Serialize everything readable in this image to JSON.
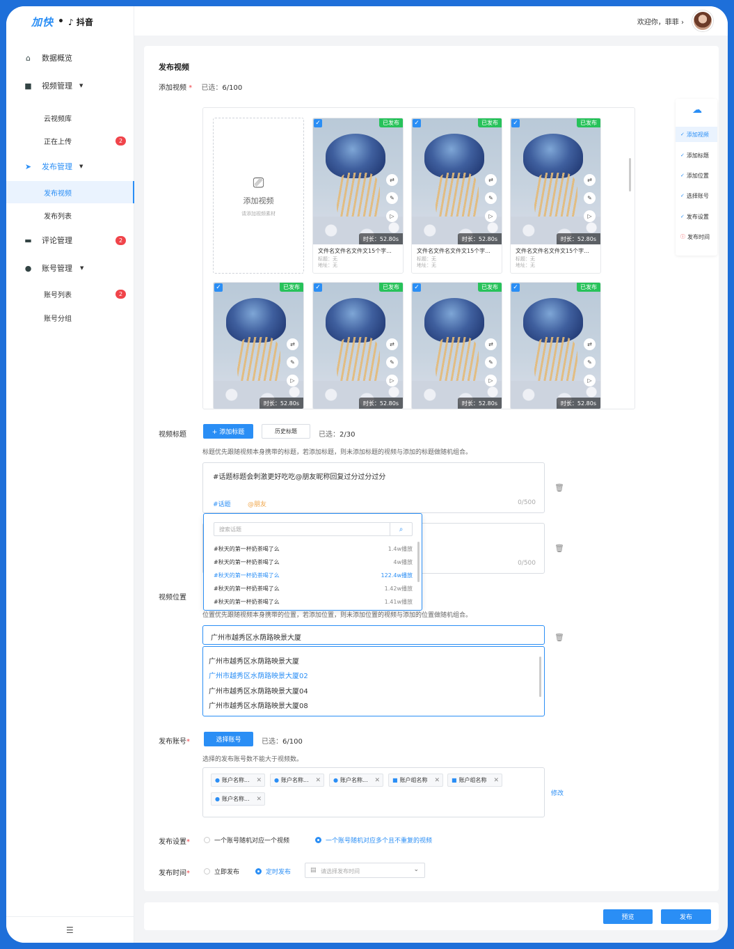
{
  "brand": {
    "left": "加快",
    "sep": "•",
    "right": "抖音"
  },
  "header": {
    "welcome": "欢迎你，菲菲 ›"
  },
  "sidebar": {
    "items": [
      {
        "label": "数据概览",
        "icon": "home-icon"
      },
      {
        "label": "视频管理",
        "icon": "video-icon"
      },
      {
        "label": "云视频库"
      },
      {
        "label": "正在上传",
        "badge": "2"
      },
      {
        "label": "发布管理",
        "icon": "send-icon"
      },
      {
        "label": "发布视频"
      },
      {
        "label": "发布列表"
      },
      {
        "label": "评论管理",
        "icon": "comment-icon",
        "badge": "2"
      },
      {
        "label": "账号管理",
        "icon": "user-icon"
      },
      {
        "label": "账号列表",
        "badge": "2"
      },
      {
        "label": "账号分组"
      }
    ],
    "collapse_icon": "☰"
  },
  "page": {
    "title": "发布视频",
    "add_video": {
      "label": "添加视频",
      "star": "*",
      "selected_label": "已选：",
      "selected": "6/100",
      "tile_title": "添加视频",
      "tile_sub": "请添加视频素材"
    },
    "videos": [
      {
        "status": "已发布",
        "duration": "时长：52.80s",
        "name": "文件名文件名文件文15个字...",
        "title": "标题：无",
        "addr": "地址：无"
      },
      {
        "status": "已发布",
        "duration": "时长：52.80s",
        "name": "文件名文件名文件文15个字...",
        "title": "标题：无",
        "addr": "地址：无"
      },
      {
        "status": "已发布",
        "duration": "时长：52.80s",
        "name": "文件名文件名文件文15个字...",
        "title": "标题：无",
        "addr": "地址：无"
      },
      {
        "status": "已发布",
        "duration": "时长：52.80s"
      },
      {
        "status": "已发布",
        "duration": "时长：52.80s"
      },
      {
        "status": "已发布",
        "duration": "时长：52.80s"
      },
      {
        "status": "已发布",
        "duration": "时长：52.80s"
      }
    ],
    "video_title": {
      "label": "视频标题",
      "add_btn": "+ 添加标题",
      "history_btn": "历史标题",
      "selected_label": "已选：",
      "selected": "2/30",
      "hint": "标题优先跟随视频本身携带的标题，若添加标题，则未添加标题的视频与添加的标题做随机组合。",
      "text1": "#话题标题会刺激更好吃吃@朋友昵称回复过分过分过分",
      "tag1": "#话题",
      "tag2": "@朋友",
      "count1": "0/500",
      "count2": "0/500"
    },
    "topic_dropdown": {
      "placeholder": "搜索话题",
      "rows": [
        {
          "name": "#秋天的第一杯奶茶喝了么",
          "plays": "1.4w播放"
        },
        {
          "name": "#秋天的第一杯奶茶喝了么",
          "plays": "4w播放"
        },
        {
          "name": "#秋天的第一杯奶茶喝了么",
          "plays": "122.4w播放"
        },
        {
          "name": "#秋天的第一杯奶茶喝了么",
          "plays": "1.42w播放"
        },
        {
          "name": "#秋天的第一杯奶茶喝了么",
          "plays": "1.41w播放"
        }
      ]
    },
    "location": {
      "label": "视频位置",
      "hint": "位置优先跟随视频本身携带的位置，若添加位置，则未添加位置的视频与添加的位置做随机组合。",
      "value": "广州市越秀区水荫路映景大厦",
      "options": [
        "广州市越秀区水荫路映景大厦",
        "广州市越秀区水荫路映景大厦02",
        "广州市越秀区水荫路映景大厦04",
        "广州市越秀区水荫路映景大厦08"
      ]
    },
    "account": {
      "label": "发布账号",
      "star": "*",
      "btn": "选择账号",
      "selected_label": "已选：",
      "selected": "6/100",
      "hint": "选择的发布账号数不能大于视频数。",
      "tags": [
        "账户名称...",
        "账户名称...",
        "账户名称...",
        "账户组名称",
        "账户组名称",
        "账户名称..."
      ],
      "edit": "修改"
    },
    "settings": {
      "label": "发布设置",
      "star": "*",
      "opt1": "一个账号随机对应一个视频",
      "opt2": "一个账号随机对应多个且不重复的视频"
    },
    "time": {
      "label": "发布时间",
      "star": "*",
      "opt1": "立即发布",
      "opt2": "定时发布",
      "placeholder": "请选择发布时间"
    }
  },
  "right_nav": [
    "添加视频",
    "添加标题",
    "添加位置",
    "选择账号",
    "发布设置",
    "发布时间"
  ],
  "footer": {
    "preview": "预览",
    "publish": "发布"
  },
  "colors": {
    "accent": "#2a8ef5",
    "success": "#27c25a",
    "danger": "#f0444a"
  }
}
